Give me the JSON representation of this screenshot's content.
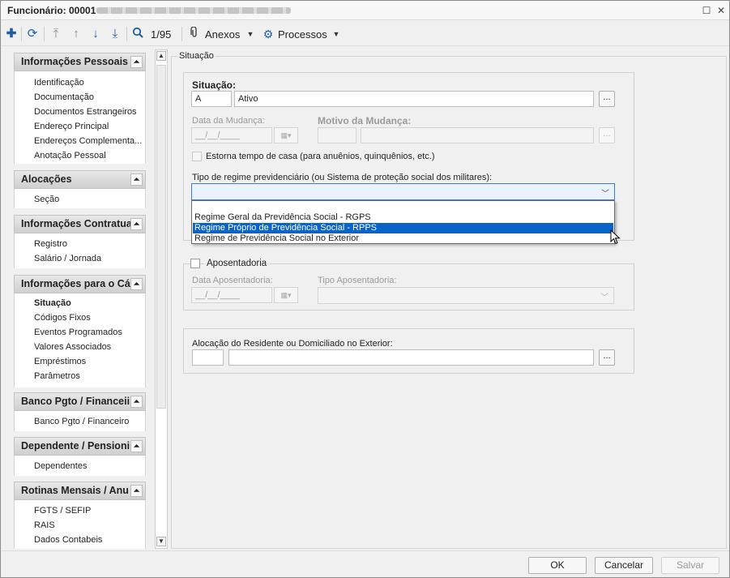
{
  "window": {
    "title": "Funcionário: 00001"
  },
  "toolbar": {
    "record_counter": "1/95",
    "anexos_label": "Anexos",
    "processos_label": "Processos"
  },
  "sidebar": {
    "sections": [
      {
        "title": "Informações Pessoais",
        "items": [
          "Identificação",
          "Documentação",
          "Documentos Estrangeiros",
          "Endereço Principal",
          "Endereços Complementa...",
          "Anotação Pessoal"
        ]
      },
      {
        "title": "Alocações",
        "items": [
          "Seção"
        ]
      },
      {
        "title": "Informações Contratuai",
        "items": [
          "Registro",
          "Salário / Jornada"
        ]
      },
      {
        "title": "Informações para o Cál",
        "items": [
          "Situação",
          "Códigos Fixos",
          "Eventos Programados",
          "Valores Associados",
          "Empréstimos",
          "Parâmetros"
        ]
      },
      {
        "title": "Banco Pgto / Financeii",
        "items": [
          "Banco Pgto / Financeiro"
        ]
      },
      {
        "title": "Dependente / Pensioni",
        "items": [
          "Dependentes"
        ]
      },
      {
        "title": "Rotinas Mensais / Anu",
        "items": [
          "FGTS / SEFIP",
          "RAIS",
          "Dados Contabeis"
        ]
      }
    ]
  },
  "form": {
    "group_title": "Situação",
    "situacao_label": "Situação:",
    "situacao_code": "A",
    "situacao_desc": "Ativo",
    "data_mudanca_label": "Data da Mudança:",
    "data_mudanca_value": "__/__/____",
    "motivo_mudanca_label": "Motivo da Mudança:",
    "estorna_label": "Estorna tempo de casa (para anuênios, quinquênios, etc.)",
    "regime_label": "Tipo de regime previdenciário (ou Sistema de proteção social dos militares):",
    "regime_options": [
      "Regime Geral da Previdência Social - RGPS",
      "Regime Próprio de Previdência Social - RPPS",
      "Regime de Previdência Social no Exterior"
    ],
    "aposentadoria_label": "Aposentadoria",
    "data_aposentadoria_label": "Data Aposentadoria:",
    "data_aposentadoria_value": "__/__/____",
    "tipo_aposentadoria_label": "Tipo Aposentadoria:",
    "alocacao_label": "Alocação do Residente ou Domiciliado no Exterior:",
    "dots_label": "..."
  },
  "footer": {
    "ok_label": "OK",
    "cancel_label": "Cancelar",
    "save_label": "Salvar"
  }
}
